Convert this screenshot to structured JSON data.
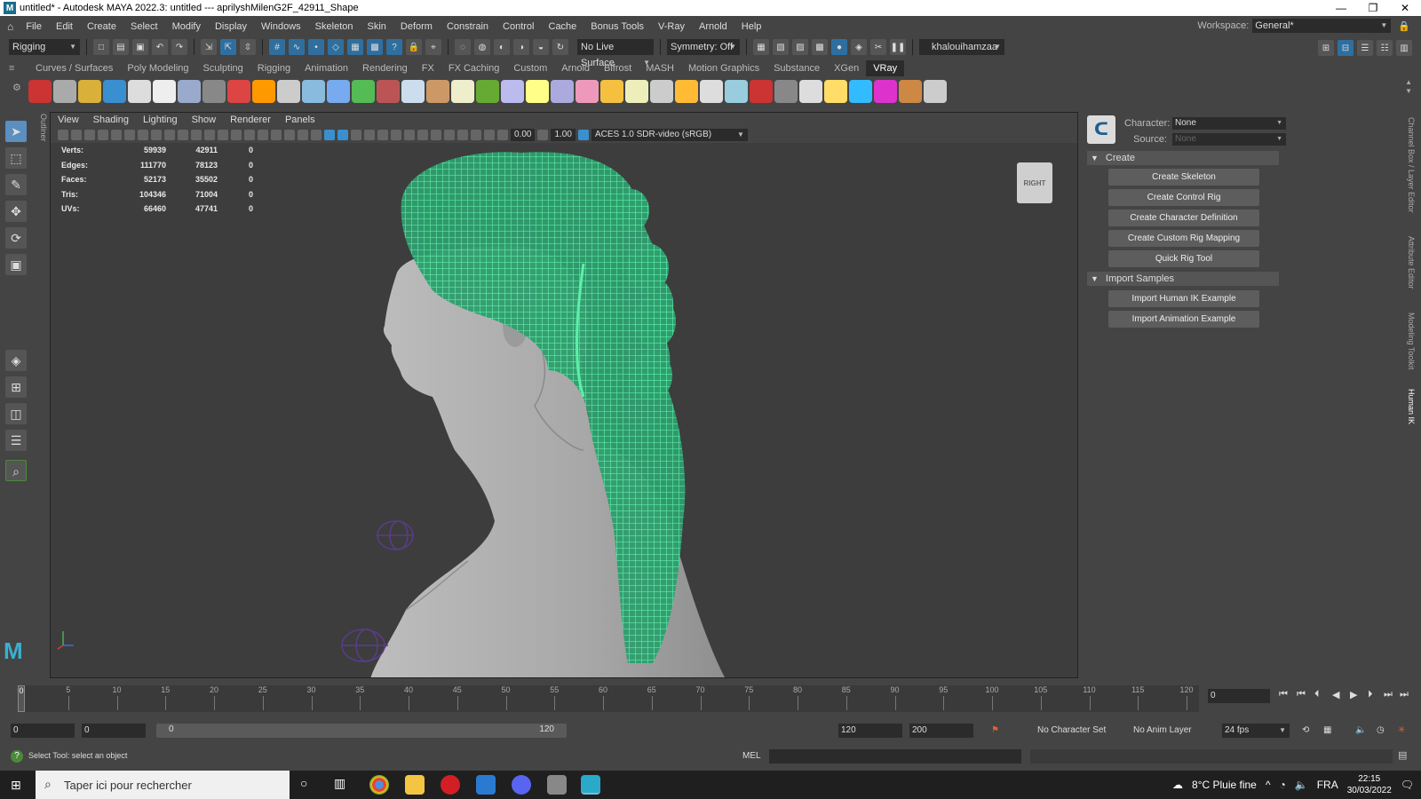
{
  "window": {
    "title": "untitled* - Autodesk MAYA 2022.3: untitled   ---   aprilyshMilenG2F_42911_Shape",
    "controls": [
      "—",
      "❐",
      "✕"
    ]
  },
  "menubar": {
    "items": [
      "File",
      "Edit",
      "Create",
      "Select",
      "Modify",
      "Display",
      "Windows",
      "Skeleton",
      "Skin",
      "Deform",
      "Constrain",
      "Control",
      "Cache",
      "Bonus Tools",
      "V-Ray",
      "Arnold",
      "Help"
    ],
    "workspace_label": "Workspace:",
    "workspace_value": "General*"
  },
  "statusline": {
    "menuset": "Rigging",
    "live_surface": "No Live Surface",
    "symmetry": "Symmetry: Off",
    "user": "khalouihamzaa"
  },
  "shelf": {
    "tabs": [
      "Curves / Surfaces",
      "Poly Modeling",
      "Sculpting",
      "Rigging",
      "Animation",
      "Rendering",
      "FX",
      "FX Caching",
      "Custom",
      "Arnold",
      "Bifrost",
      "MASH",
      "Motion Graphics",
      "Substance",
      "XGen",
      "VRay"
    ],
    "active_tab": "VRay",
    "icon_colors": [
      "#c33",
      "#aaa",
      "#d9b03a",
      "#3a8fd0",
      "#ddd",
      "#eee",
      "#9ac",
      "#888",
      "#d44",
      "#f90",
      "#ccc",
      "#8bd",
      "#7ae",
      "#5b5",
      "#b55",
      "#cde",
      "#c96",
      "#eec",
      "#6a3",
      "#bbe",
      "#ff8",
      "#aad",
      "#e9b",
      "#f5c040",
      "#eeb",
      "#ccc",
      "#fb3",
      "#ddd",
      "#9cd",
      "#c33",
      "#888",
      "#ddd",
      "#fd6",
      "#3bf",
      "#d3c",
      "#c84",
      "#ccc"
    ]
  },
  "outliner_label": "Outliner",
  "viewport": {
    "menus": [
      "View",
      "Shading",
      "Lighting",
      "Show",
      "Renderer",
      "Panels"
    ],
    "field_a": "0.00",
    "field_b": "1.00",
    "colorspace": "ACES 1.0 SDR-video (sRGB)",
    "hud": [
      {
        "label": "Verts:",
        "v1": "59939",
        "v2": "42911",
        "v3": "0"
      },
      {
        "label": "Edges:",
        "v1": "111770",
        "v2": "78123",
        "v3": "0"
      },
      {
        "label": "Faces:",
        "v1": "52173",
        "v2": "35502",
        "v3": "0"
      },
      {
        "label": "Tris:",
        "v1": "104346",
        "v2": "71004",
        "v3": "0"
      },
      {
        "label": "UVs:",
        "v1": "66460",
        "v2": "47741",
        "v3": "0"
      }
    ],
    "viewcube": "RIGHT",
    "wire_color": "#5cf0a8"
  },
  "humanik": {
    "character_label": "Character:",
    "character_value": "None",
    "source_label": "Source:",
    "source_value": "None",
    "create_section": "Create",
    "create_buttons": [
      "Create Skeleton",
      "Create Control Rig",
      "Create Character Definition",
      "Create Custom Rig Mapping",
      "Quick Rig Tool"
    ],
    "import_section": "Import Samples",
    "import_buttons": [
      "Import Human IK Example",
      "Import Animation Example"
    ]
  },
  "right_tabs": [
    "Channel Box / Layer Editor",
    "Attribute Editor",
    "Modeling Toolkit",
    "Human IK"
  ],
  "timeline": {
    "ticks": [
      "0",
      "5",
      "10",
      "15",
      "20",
      "25",
      "30",
      "35",
      "40",
      "45",
      "50",
      "55",
      "60",
      "65",
      "70",
      "75",
      "80",
      "85",
      "90",
      "95",
      "100",
      "105",
      "110",
      "115",
      "120"
    ],
    "current_frame": "0",
    "current_marker": "0",
    "playback_icons": [
      "⏮",
      "⏮",
      "⏴",
      "◀",
      "▶",
      "⏵",
      "⏭",
      "⏭"
    ]
  },
  "range": {
    "start": "0",
    "inner_start": "0",
    "slider_start": "0",
    "slider_end": "120",
    "anim_end": "120",
    "max_end": "200",
    "character_set": "No Character Set",
    "anim_layer": "No Anim Layer",
    "fps": "24 fps"
  },
  "cmdline": {
    "help": "Select Tool: select an object",
    "lang": "MEL"
  },
  "taskbar": {
    "search_placeholder": "Taper ici pour rechercher",
    "weather": "8°C  Pluie fine",
    "lang": "FRA",
    "time": "22:15",
    "date": "30/03/2022"
  }
}
